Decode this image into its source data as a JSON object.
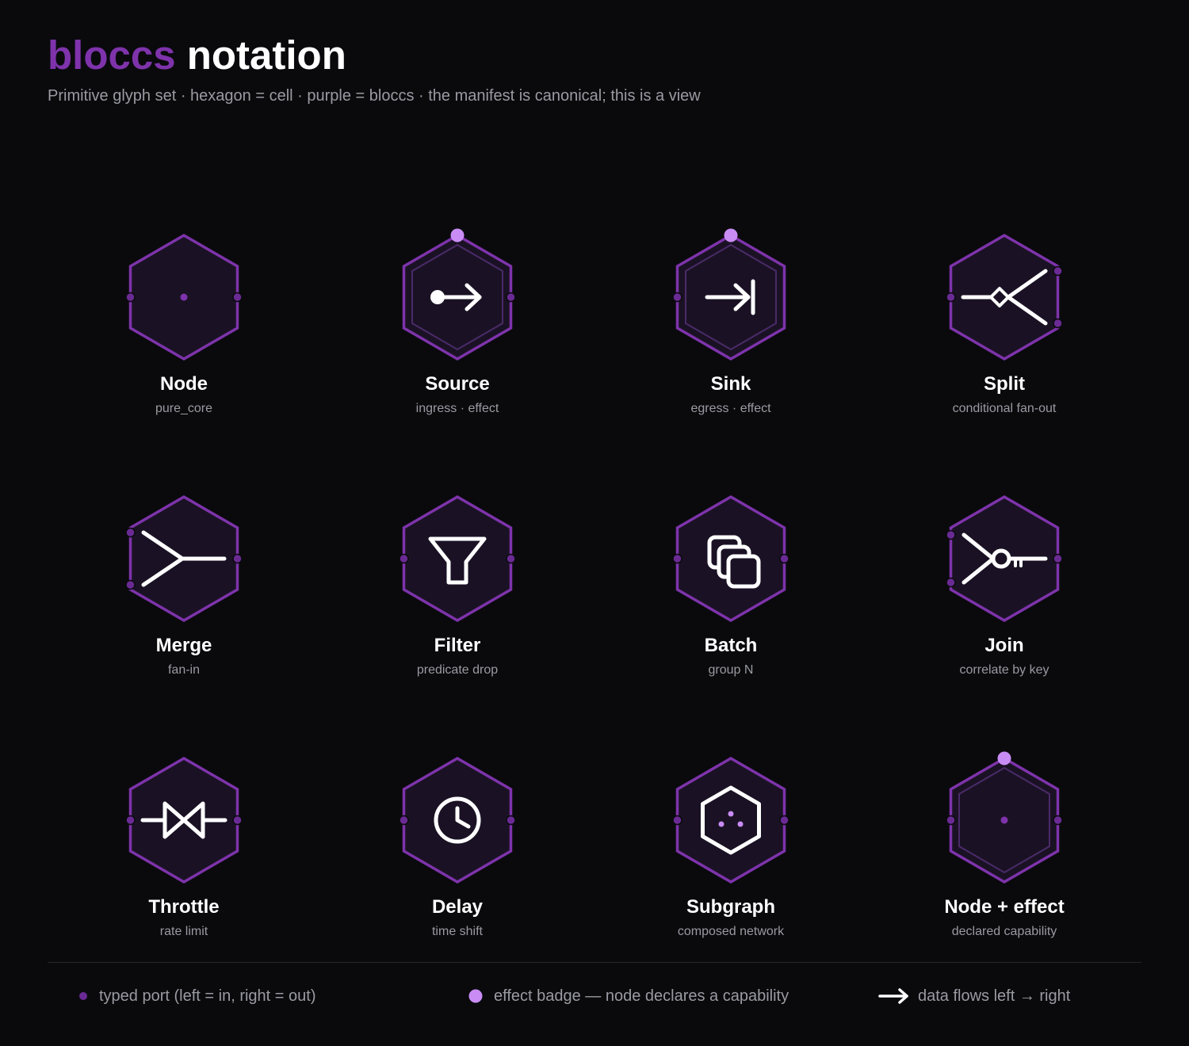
{
  "header": {
    "title_brand": "bloccs",
    "title_rest": "notation",
    "subtitle": "Primitive glyph set · hexagon = cell · purple = bloccs · the manifest is canonical; this is a view"
  },
  "colors": {
    "background": "#0a0a0d",
    "hex_stroke": "#7e33ab",
    "hex_fill": "#1a1224",
    "inner_stroke": "#4a2a68",
    "port": "#6a2a94",
    "badge": "#c98cf5",
    "glyph": "#ffffff",
    "muted_text": "#9a9aa2"
  },
  "glyphs": [
    {
      "name": "Node",
      "desc": "pure_core",
      "icon": "dot-icon"
    },
    {
      "name": "Source",
      "desc": "ingress · effect",
      "icon": "ingress-arrow-icon"
    },
    {
      "name": "Sink",
      "desc": "egress · effect",
      "icon": "egress-arrow-icon"
    },
    {
      "name": "Split",
      "desc": "conditional fan-out",
      "icon": "split-icon"
    },
    {
      "name": "Merge",
      "desc": "fan-in",
      "icon": "merge-icon"
    },
    {
      "name": "Filter",
      "desc": "predicate drop",
      "icon": "funnel-icon"
    },
    {
      "name": "Batch",
      "desc": "group N",
      "icon": "stacked-squares-icon"
    },
    {
      "name": "Join",
      "desc": "correlate by key",
      "icon": "key-icon"
    },
    {
      "name": "Throttle",
      "desc": "rate limit",
      "icon": "bowtie-valve-icon"
    },
    {
      "name": "Delay",
      "desc": "time shift",
      "icon": "clock-icon"
    },
    {
      "name": "Subgraph",
      "desc": "composed network",
      "icon": "nested-hexagon-icon"
    },
    {
      "name": "Node + effect",
      "desc": "declared capability",
      "icon": "dot-icon"
    }
  ],
  "legend": {
    "port": "typed port (left = in, right = out)",
    "badge": "effect badge — node declares a capability",
    "flow": "data flows left → right"
  }
}
